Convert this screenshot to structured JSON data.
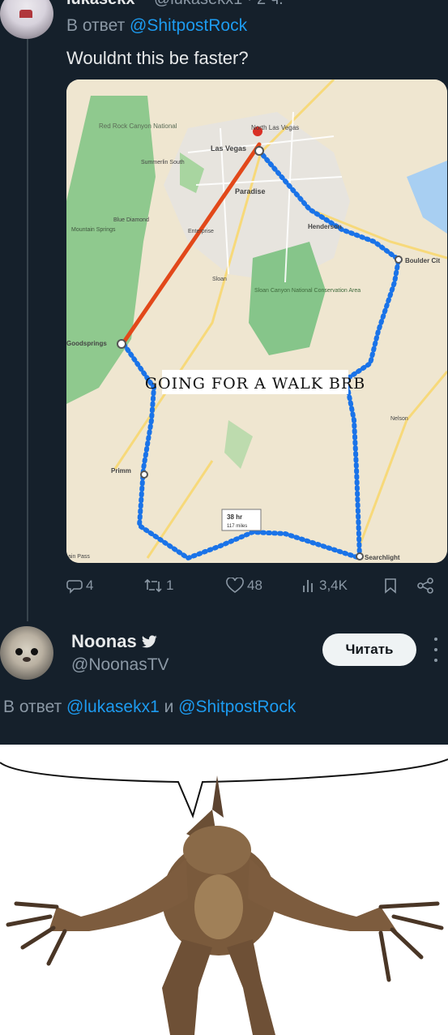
{
  "tweet1": {
    "author_name": "lukasekx",
    "author_handle": "@lukasekx1 · 2 ч.",
    "reply_prefix": "В ответ",
    "reply_to": "@ShitpostRock",
    "text": "Wouldnt this be faster?",
    "map": {
      "overlay_text": "GOING FOR A WALK BRB",
      "labels": {
        "red_rock": "Red Rock Canyon National",
        "north_las_vegas": "North Las Vegas",
        "las_vegas": "Las Vegas",
        "summerlin": "Summerlin South",
        "paradise": "Paradise",
        "blue_diamond": "Blue Diamond",
        "enterprise": "Enterprise",
        "henderson": "Henderson",
        "mountain_springs": "Mountain Springs",
        "boulder_city": "Boulder Cit",
        "sloan": "Sloan",
        "sloan_canyon": "Sloan Canyon National Conservation Area",
        "goodsprings": "Goodsprings",
        "nelson": "Nelson",
        "primm": "Primm",
        "duration": "38 hr",
        "distance": "117 miles",
        "searchlight": "Searchlight",
        "mountain_pass": "ain Pass"
      },
      "colors": {
        "walk_route": "#1a73e8",
        "direct_route": "#e2481a",
        "park": "#86c58a",
        "water": "#a8cff2"
      }
    },
    "actions": {
      "replies": "4",
      "retweets": "1",
      "likes": "48",
      "views": "3,4K"
    }
  },
  "tweet2": {
    "author_name": "Noonas",
    "author_handle": "@NoonasTV",
    "follow_label": "Читать",
    "reply_prefix": "В ответ",
    "reply_to_1": "@lukasekx1",
    "reply_and": "и",
    "reply_to_2": "@ShitpostRock",
    "image": "deathclaw-speech-bubble-meme"
  }
}
